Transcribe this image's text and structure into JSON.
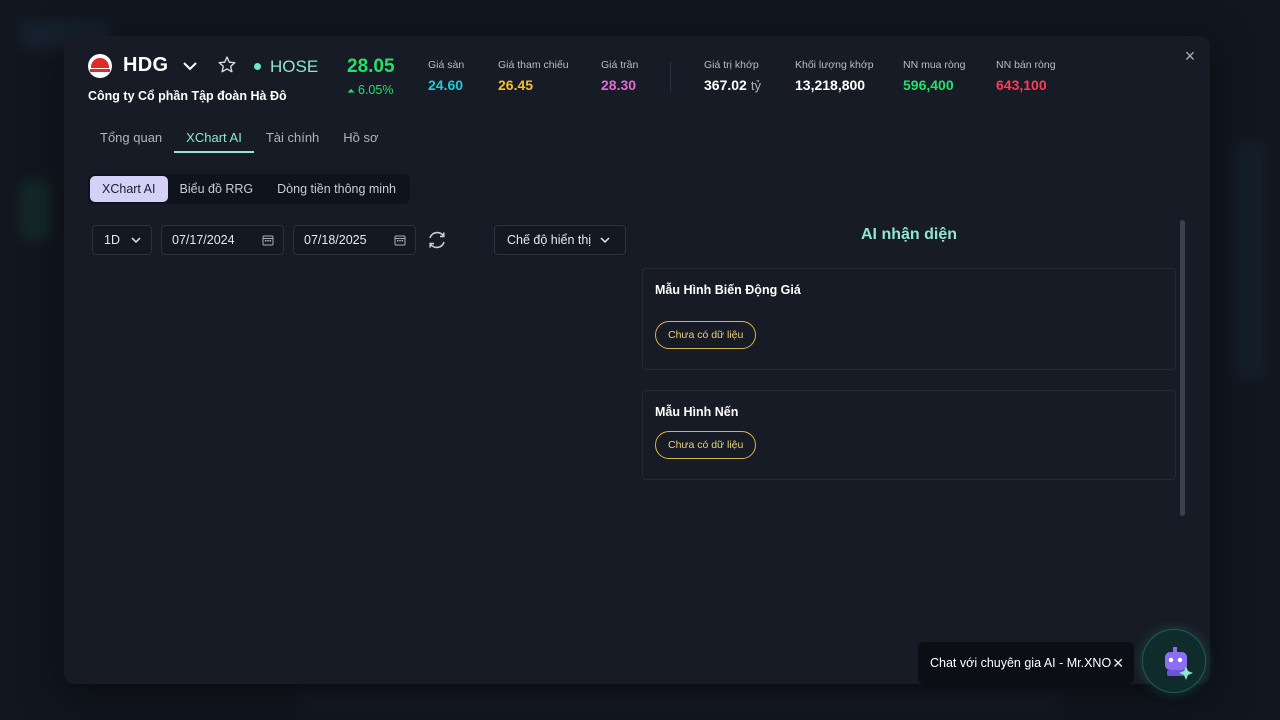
{
  "stock": {
    "ticker": "HDG",
    "exchange": "HOSE",
    "company": "Công ty Cổ phần Tập đoàn Hà Đô",
    "price": "28.05",
    "change_pct": "6.05%"
  },
  "stats": [
    {
      "label": "Giá sàn",
      "value": "24.60",
      "color": "#22c8d8"
    },
    {
      "label": "Giá tham chiếu",
      "value": "26.45",
      "color": "#f2c12e"
    },
    {
      "label": "Giá trần",
      "value": "28.30",
      "color": "#e16ad8"
    },
    {
      "label": "Giá trị khớp",
      "value": "367.02",
      "unit": "tỷ",
      "color": "#ffffff"
    },
    {
      "label": "Khối lượng khớp",
      "value": "13,218,800",
      "color": "#ffffff"
    },
    {
      "label": "NN mua ròng",
      "value": "596,400",
      "color": "#22e06c"
    },
    {
      "label": "NN bán ròng",
      "value": "643,100",
      "color": "#ff3b57"
    }
  ],
  "tabs": [
    "Tổng quan",
    "XChart AI",
    "Tài chính",
    "Hồ sơ"
  ],
  "active_tab": "XChart AI",
  "subtabs": [
    "XChart AI",
    "Biểu đồ RRG",
    "Dòng tiền thông minh"
  ],
  "controls": {
    "interval": "1D",
    "date_from": "07/17/2024",
    "date_to": "07/18/2025",
    "display_mode": "Chế độ hiển thị"
  },
  "ai_panel": {
    "title": "AI nhận diện",
    "cards": [
      {
        "title": "Mẫu Hình Biến Động Giá",
        "status": "Chưa có dữ liệu"
      },
      {
        "title": "Mẫu Hình Nến",
        "status": "Chưa có dữ liệu"
      }
    ]
  },
  "chat": {
    "tooltip": "Chat với chuyên gia AI - Mr.XNO"
  },
  "colors": {
    "accent": "#8de6cf",
    "up": "#22e06c",
    "warning_pill": "#d4b547"
  }
}
